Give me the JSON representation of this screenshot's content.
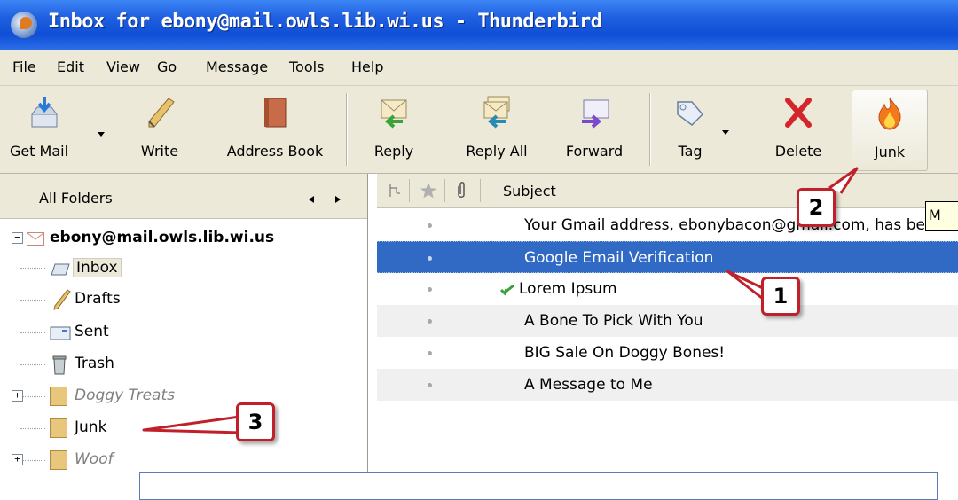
{
  "window": {
    "title": "Inbox for ebony@mail.owls.lib.wi.us - Thunderbird"
  },
  "menu": [
    "File",
    "Edit",
    "View",
    "Go",
    "Message",
    "Tools",
    "Help"
  ],
  "toolbar": {
    "get_mail": "Get Mail",
    "write": "Write",
    "address_book": "Address Book",
    "reply": "Reply",
    "reply_all": "Reply All",
    "forward": "Forward",
    "tag": "Tag",
    "delete": "Delete",
    "junk": "Junk"
  },
  "folder_pane": {
    "header": "All Folders",
    "account": "ebony@mail.owls.lib.wi.us",
    "folders": [
      "Inbox",
      "Drafts",
      "Sent",
      "Trash",
      "Doggy Treats",
      "Junk",
      "Woof"
    ]
  },
  "message_list": {
    "column_subject": "Subject",
    "messages": [
      {
        "subject": "Your Gmail address, ebonybacon@gmail.com, has been created",
        "selected": false,
        "replied": false
      },
      {
        "subject": "Google Email Verification",
        "selected": true,
        "replied": false
      },
      {
        "subject": "Lorem Ipsum",
        "selected": false,
        "replied": true
      },
      {
        "subject": "A Bone To Pick With You",
        "selected": false,
        "replied": false
      },
      {
        "subject": "BIG Sale On Doggy Bones!",
        "selected": false,
        "replied": false
      },
      {
        "subject": "A Message to Me",
        "selected": false,
        "replied": false
      }
    ]
  },
  "tooltip": "M",
  "callouts": [
    "1",
    "2",
    "3"
  ],
  "colors": {
    "selection": "#316ac5",
    "callout_border": "#c0202a",
    "titlebar": "#1f5fe0"
  }
}
